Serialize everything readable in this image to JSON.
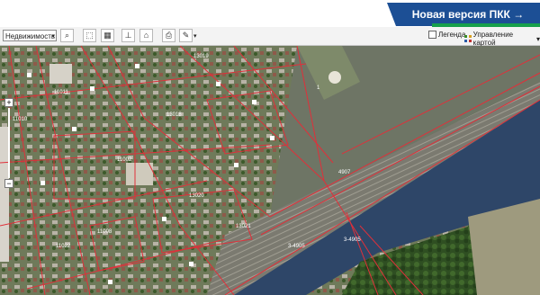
{
  "promo": {
    "label": "Новая версия ПКК →"
  },
  "toolbar": {
    "layer_select": "Недвижимость",
    "legend_label": "Легенда",
    "map_control_label": "Управление картой"
  },
  "zoom": {
    "plus": "+",
    "minus": "−"
  },
  "map": {
    "cadastral_labels": [
      "11011",
      "11010",
      "13019",
      "13018",
      "13020",
      "13021",
      "11002",
      "11008",
      "11022",
      "1",
      "4907",
      "3-4905",
      "3-4905"
    ],
    "colors": {
      "parcel_line": "#e0303a",
      "river": "#2e4668",
      "forest": "#355a2a",
      "urban": "#8a8f7e"
    }
  }
}
